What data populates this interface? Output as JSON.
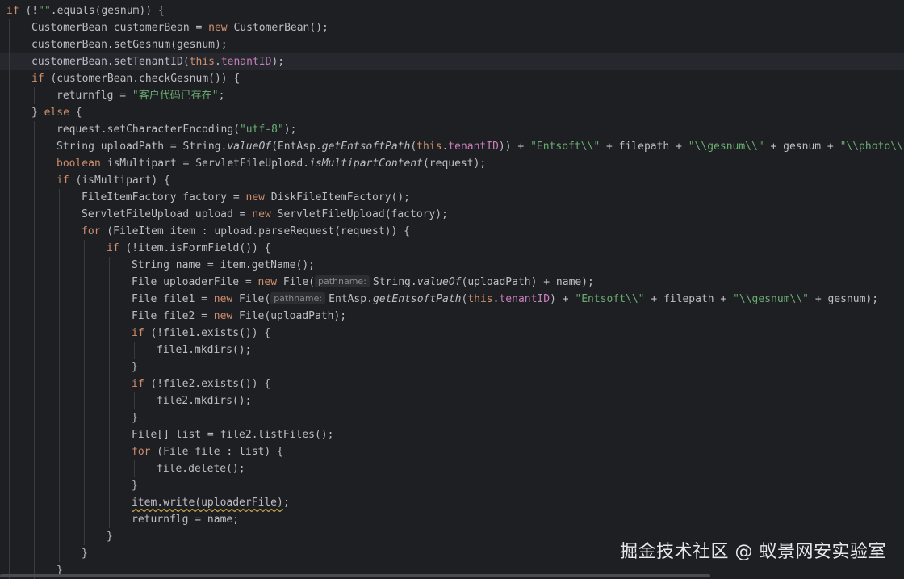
{
  "lines": [
    {
      "indent": 0,
      "segments": [
        [
          "kw",
          "if"
        ],
        [
          "t",
          " (!"
        ],
        [
          "str",
          "\"\""
        ],
        [
          "t",
          ".equals(gesnum)) {"
        ]
      ]
    },
    {
      "indent": 1,
      "segments": [
        [
          "t",
          "CustomerBean customerBean = "
        ],
        [
          "kw",
          "new"
        ],
        [
          "t",
          " CustomerBean();"
        ]
      ]
    },
    {
      "indent": 1,
      "segments": [
        [
          "t",
          "customerBean.setGesnum(gesnum);"
        ]
      ]
    },
    {
      "indent": 1,
      "current": true,
      "segments": [
        [
          "t",
          "customerBean.setTenantID("
        ],
        [
          "kw",
          "this"
        ],
        [
          "t",
          "."
        ],
        [
          "fld",
          "tenantID"
        ],
        [
          "t",
          ");"
        ]
      ]
    },
    {
      "indent": 1,
      "segments": [
        [
          "kw",
          "if"
        ],
        [
          "t",
          " (customerBean.checkGesnum()) {"
        ]
      ]
    },
    {
      "indent": 2,
      "segments": [
        [
          "t",
          "returnflg = "
        ],
        [
          "str",
          "\"客户代码已存在\""
        ],
        [
          "t",
          ";"
        ]
      ]
    },
    {
      "indent": 1,
      "segments": [
        [
          "t",
          "} "
        ],
        [
          "kw",
          "else"
        ],
        [
          "t",
          " {"
        ]
      ]
    },
    {
      "indent": 2,
      "segments": [
        [
          "t",
          "request.setCharacterEncoding("
        ],
        [
          "str",
          "\"utf-8\""
        ],
        [
          "t",
          ");"
        ]
      ]
    },
    {
      "indent": 2,
      "segments": [
        [
          "t",
          "String uploadPath = String."
        ],
        [
          "it",
          "valueOf"
        ],
        [
          "t",
          "(EntAsp."
        ],
        [
          "it",
          "getEntsoftPath"
        ],
        [
          "t",
          "("
        ],
        [
          "kw",
          "this"
        ],
        [
          "t",
          "."
        ],
        [
          "fld",
          "tenantID"
        ],
        [
          "t",
          ")) + "
        ],
        [
          "str",
          "\"Entsoft\\\\\""
        ],
        [
          "t",
          " + filepath + "
        ],
        [
          "str",
          "\"\\\\gesnum\\\\\""
        ],
        [
          "t",
          " + gesnum + "
        ],
        [
          "str",
          "\"\\\\photo\\\\\""
        ],
        [
          "t",
          ";"
        ]
      ]
    },
    {
      "indent": 2,
      "segments": [
        [
          "kw",
          "boolean"
        ],
        [
          "t",
          " isMultipart = ServletFileUpload."
        ],
        [
          "it",
          "isMultipartContent"
        ],
        [
          "t",
          "(request);"
        ]
      ]
    },
    {
      "indent": 2,
      "segments": [
        [
          "kw",
          "if"
        ],
        [
          "t",
          " (isMultipart) {"
        ]
      ]
    },
    {
      "indent": 3,
      "segments": [
        [
          "t",
          "FileItemFactory factory = "
        ],
        [
          "kw",
          "new"
        ],
        [
          "t",
          " DiskFileItemFactory();"
        ]
      ]
    },
    {
      "indent": 3,
      "segments": [
        [
          "t",
          "ServletFileUpload upload = "
        ],
        [
          "kw",
          "new"
        ],
        [
          "t",
          " ServletFileUpload(factory);"
        ]
      ]
    },
    {
      "indent": 3,
      "segments": [
        [
          "kw",
          "for"
        ],
        [
          "t",
          " (FileItem item : upload.parseRequest(request)) {"
        ]
      ]
    },
    {
      "indent": 4,
      "segments": [
        [
          "kw",
          "if"
        ],
        [
          "t",
          " (!item.isFormField()) {"
        ]
      ]
    },
    {
      "indent": 5,
      "segments": [
        [
          "t",
          "String name = item.getName();"
        ]
      ]
    },
    {
      "indent": 5,
      "segments": [
        [
          "t",
          "File uploaderFile = "
        ],
        [
          "kw",
          "new"
        ],
        [
          "t",
          " File("
        ],
        [
          "hint",
          "pathname:"
        ],
        [
          "t",
          "String."
        ],
        [
          "it",
          "valueOf"
        ],
        [
          "t",
          "(uploadPath) + name);"
        ]
      ]
    },
    {
      "indent": 5,
      "segments": [
        [
          "t",
          "File file1 = "
        ],
        [
          "kw",
          "new"
        ],
        [
          "t",
          " File("
        ],
        [
          "hint",
          "pathname:"
        ],
        [
          "t",
          "EntAsp."
        ],
        [
          "it",
          "getEntsoftPath"
        ],
        [
          "t",
          "("
        ],
        [
          "kw",
          "this"
        ],
        [
          "t",
          "."
        ],
        [
          "fld",
          "tenantID"
        ],
        [
          "t",
          ") + "
        ],
        [
          "str",
          "\"Entsoft\\\\\""
        ],
        [
          "t",
          " + filepath + "
        ],
        [
          "str",
          "\"\\\\gesnum\\\\\""
        ],
        [
          "t",
          " + gesnum);"
        ]
      ]
    },
    {
      "indent": 5,
      "segments": [
        [
          "t",
          "File file2 = "
        ],
        [
          "kw",
          "new"
        ],
        [
          "t",
          " File(uploadPath);"
        ]
      ]
    },
    {
      "indent": 5,
      "segments": [
        [
          "kw",
          "if"
        ],
        [
          "t",
          " (!file1.exists()) {"
        ]
      ]
    },
    {
      "indent": 6,
      "segments": [
        [
          "t",
          "file1.mkdirs();"
        ]
      ]
    },
    {
      "indent": 5,
      "segments": [
        [
          "t",
          "}"
        ]
      ]
    },
    {
      "indent": 5,
      "segments": [
        [
          "kw",
          "if"
        ],
        [
          "t",
          " (!file2.exists()) {"
        ]
      ]
    },
    {
      "indent": 6,
      "segments": [
        [
          "t",
          "file2.mkdirs();"
        ]
      ]
    },
    {
      "indent": 5,
      "segments": [
        [
          "t",
          "}"
        ]
      ]
    },
    {
      "indent": 5,
      "segments": [
        [
          "t",
          "File[] list = file2.listFiles();"
        ]
      ]
    },
    {
      "indent": 5,
      "segments": [
        [
          "kw",
          "for"
        ],
        [
          "t",
          " (File file : list) {"
        ]
      ]
    },
    {
      "indent": 6,
      "segments": [
        [
          "t",
          "file.delete();"
        ]
      ]
    },
    {
      "indent": 5,
      "segments": [
        [
          "t",
          "}"
        ]
      ]
    },
    {
      "indent": 5,
      "segments": [
        [
          "warn",
          "item.write(uploaderFile)"
        ],
        [
          "t",
          ";"
        ]
      ]
    },
    {
      "indent": 5,
      "segments": [
        [
          "t",
          "returnflg = name;"
        ]
      ]
    },
    {
      "indent": 4,
      "segments": [
        [
          "t",
          "}"
        ]
      ]
    },
    {
      "indent": 3,
      "segments": [
        [
          "t",
          "}"
        ]
      ]
    },
    {
      "indent": 2,
      "segments": [
        [
          "t",
          "}"
        ]
      ]
    }
  ],
  "watermark": "掘金技术社区 @ 蚁景网安实验室",
  "colors": {
    "background": "#1e1f22",
    "text": "#bcbec4",
    "keyword": "#cf8e6d",
    "string": "#6aab73",
    "field": "#c77dbb"
  }
}
